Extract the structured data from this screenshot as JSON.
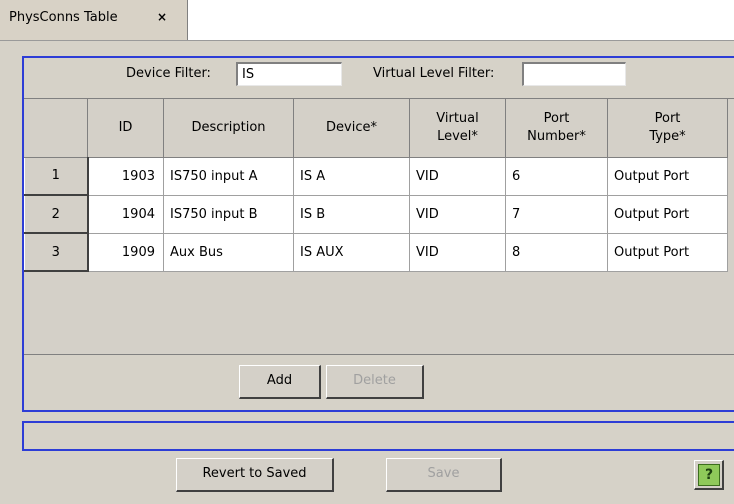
{
  "tab": {
    "title": "PhysConns Table",
    "close_glyph": "×"
  },
  "filters": {
    "device_label": "Device Filter:",
    "device_value": "IS",
    "virtual_label": "Virtual Level Filter:",
    "virtual_value": ""
  },
  "table": {
    "columns": [
      "ID",
      "Description",
      "Device*",
      "Virtual Level*",
      "Port Number*",
      "Port Type*"
    ],
    "column_lines": [
      [
        "ID"
      ],
      [
        "Description"
      ],
      [
        "Device*"
      ],
      [
        "Virtual",
        "Level*"
      ],
      [
        "Port",
        "Number*"
      ],
      [
        "Port",
        "Type*"
      ]
    ],
    "rows": [
      {
        "num": "1",
        "id": "1903",
        "description": "IS750 input A",
        "device": "IS A",
        "virtual_level": "VID",
        "port_number": "6",
        "port_type": "Output Port"
      },
      {
        "num": "2",
        "id": "1904",
        "description": "IS750 input B",
        "device": "IS B",
        "virtual_level": "VID",
        "port_number": "7",
        "port_type": "Output Port"
      },
      {
        "num": "3",
        "id": "1909",
        "description": "Aux Bus",
        "device": "IS AUX",
        "virtual_level": "VID",
        "port_number": "8",
        "port_type": "Output Port"
      }
    ]
  },
  "buttons": {
    "add": "Add",
    "delete": "Delete",
    "revert": "Revert to Saved",
    "save": "Save"
  },
  "status_text": "",
  "icons": {
    "help": "help-icon"
  },
  "colors": {
    "accent_border": "#2d3dd6",
    "panel": "#d6d2c8"
  }
}
